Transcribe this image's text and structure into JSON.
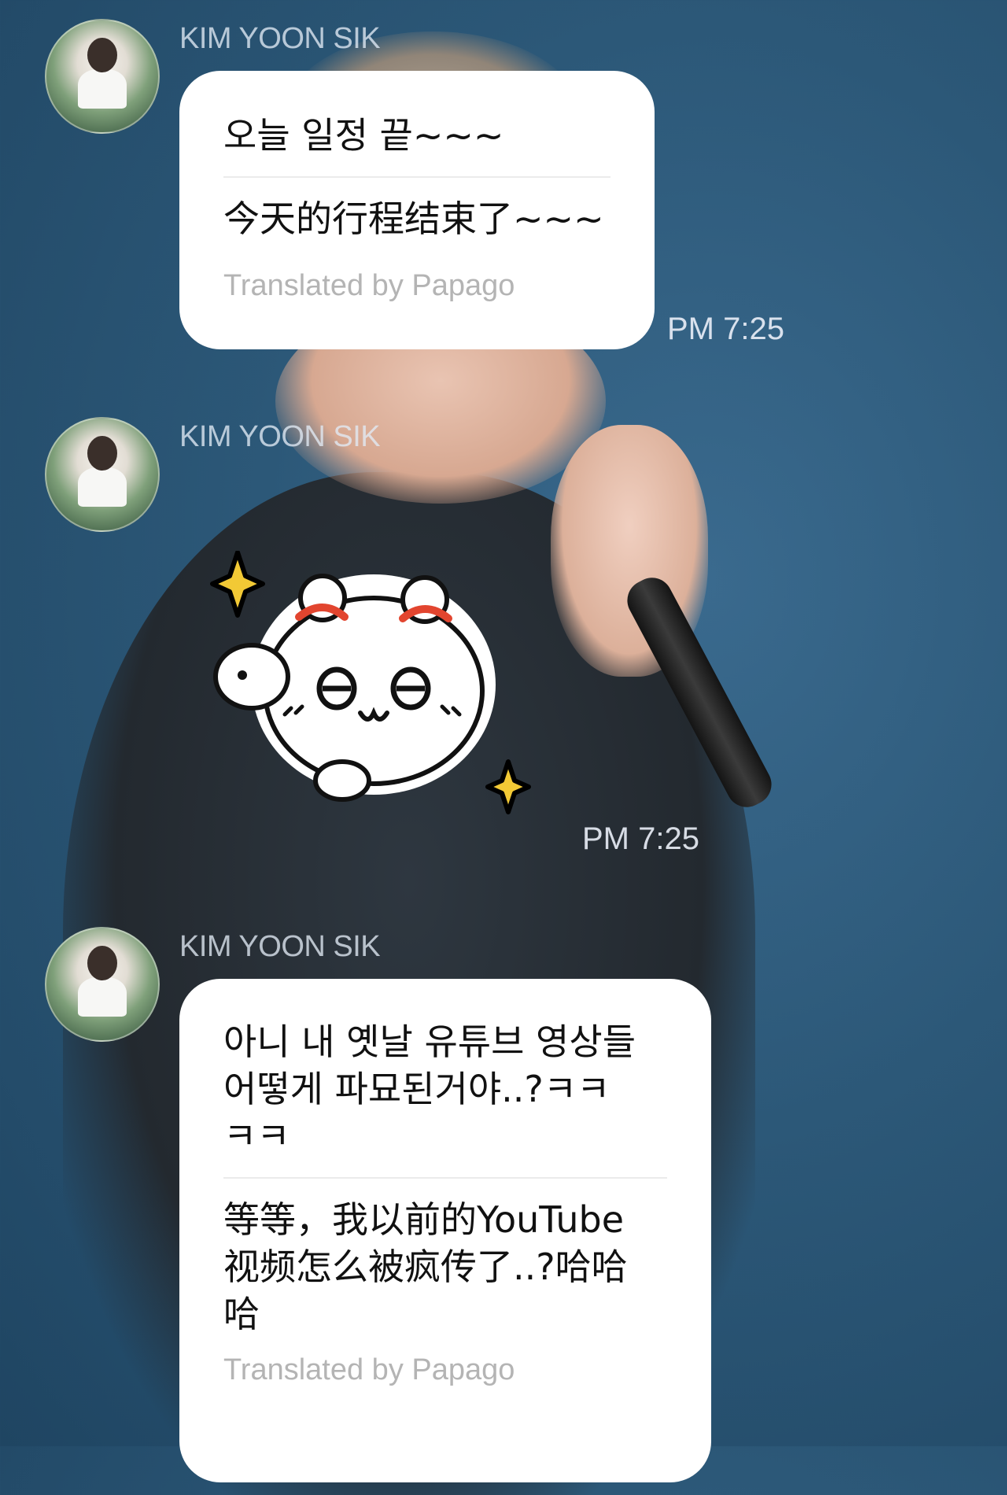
{
  "messages": [
    {
      "sender": "KIM YOON SIK",
      "original": [
        "오늘 일정 끝~~~"
      ],
      "translation": [
        "今天的行程结束了~~~"
      ],
      "credit": "Translated by Papago",
      "time": "PM 7:25"
    },
    {
      "sender": "KIM YOON SIK",
      "sticker": "sticker-cartoon-face",
      "time": "PM 7:25"
    },
    {
      "sender": "KIM YOON SIK",
      "original": [
        "아니 내 옛날 유튜브 영상들",
        "어떻게 파묘된거야..?ㅋㅋ",
        "ㅋㅋ"
      ],
      "translation": [
        "等等，我以前的YouTube",
        "视频怎么被疯传了..?哈哈",
        "哈"
      ],
      "credit": "Translated by Papago"
    }
  ],
  "colors": {
    "background": "#2c5878",
    "bubble": "#ffffff",
    "credit_text": "#b4b4b4",
    "sparkle": "#f2c935",
    "ribbon": "#e2452f"
  }
}
